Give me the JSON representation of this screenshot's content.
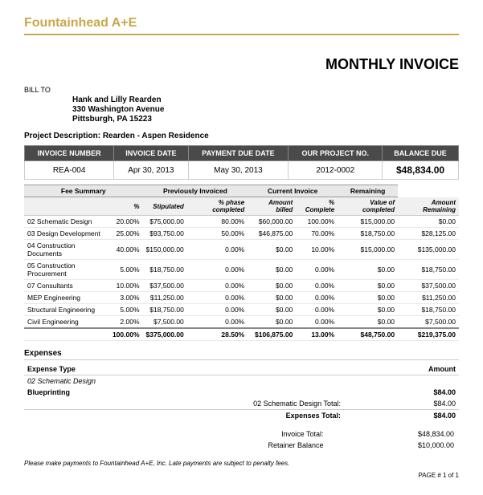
{
  "company": {
    "name": "Fountainhead",
    "suffix": " A+E"
  },
  "invoice_title": "MONTHLY INVOICE",
  "bill_to_label": "BILL TO",
  "client": {
    "name": "Hank and Lilly Rearden",
    "address1": "330 Washington Avenue",
    "address2": "Pittsburgh,  PA  15223"
  },
  "project_description_label": "Project Description:",
  "project_description": "Rearden - Aspen Residence",
  "table_headers": {
    "invoice_number": "INVOICE NUMBER",
    "invoice_date": "INVOICE DATE",
    "payment_due_date": "PAYMENT DUE DATE",
    "our_project_no": "OUR PROJECT NO.",
    "balance_due": "BALANCE DUE"
  },
  "invoice_info": {
    "invoice_number": "REA-004",
    "invoice_date": "Apr 30, 2013",
    "payment_due_date": "May 30, 2013",
    "project_no": "2012-0002",
    "balance_due": "$48,834.00"
  },
  "fee_summary": {
    "group_headers": [
      "Fee Summary",
      "Previously Invoiced",
      "Current Invoice",
      "Remaining"
    ],
    "sub_headers": [
      "",
      "%",
      "Stipulated",
      "% phase completed",
      "Amount billed",
      "%\nComplete",
      "Value of completed",
      "Amount Remaining"
    ],
    "rows": [
      {
        "label": "02 Schematic Design",
        "pct": "20.00%",
        "stipulated": "$75,000.00",
        "phase_pct": "80.00%",
        "amount_billed": "$60,000.00",
        "complete_pct": "100.00%",
        "value_completed": "$15,000.00",
        "remaining": "$0.00"
      },
      {
        "label": "03 Design Development",
        "pct": "25.00%",
        "stipulated": "$93,750.00",
        "phase_pct": "50.00%",
        "amount_billed": "$46,875.00",
        "complete_pct": "70.00%",
        "value_completed": "$18,750.00",
        "remaining": "$28,125.00"
      },
      {
        "label": "04 Construction Documents",
        "pct": "40.00%",
        "stipulated": "$150,000.00",
        "phase_pct": "0.00%",
        "amount_billed": "$0.00",
        "complete_pct": "10.00%",
        "value_completed": "$15,000.00",
        "remaining": "$135,000.00"
      },
      {
        "label": "05 Construction Procurement",
        "pct": "5.00%",
        "stipulated": "$18,750.00",
        "phase_pct": "0.00%",
        "amount_billed": "$0.00",
        "complete_pct": "0.00%",
        "value_completed": "$0.00",
        "remaining": "$18,750.00"
      },
      {
        "label": "07 Consultants",
        "pct": "10.00%",
        "stipulated": "$37,500.00",
        "phase_pct": "0.00%",
        "amount_billed": "$0.00",
        "complete_pct": "0.00%",
        "value_completed": "$0.00",
        "remaining": "$37,500.00"
      },
      {
        "label": "  MEP Engineering",
        "pct": "3.00%",
        "stipulated": "$11,250.00",
        "phase_pct": "0.00%",
        "amount_billed": "$0.00",
        "complete_pct": "0.00%",
        "value_completed": "$0.00",
        "remaining": "$11,250.00"
      },
      {
        "label": "  Structural Engineering",
        "pct": "5.00%",
        "stipulated": "$18,750.00",
        "phase_pct": "0.00%",
        "amount_billed": "$0.00",
        "complete_pct": "0.00%",
        "value_completed": "$0.00",
        "remaining": "$18,750.00"
      },
      {
        "label": "  Civil Engineering",
        "pct": "2.00%",
        "stipulated": "$7,500.00",
        "phase_pct": "0.00%",
        "amount_billed": "$0.00",
        "complete_pct": "0.00%",
        "value_completed": "$0.00",
        "remaining": "$7,500.00"
      }
    ],
    "total": {
      "label": "",
      "pct": "100.00%",
      "stipulated": "$375,000.00",
      "phase_pct": "28.50%",
      "amount_billed": "$106,875.00",
      "complete_pct": "13.00%",
      "value_completed": "$48,750.00",
      "remaining": "$219,375.00"
    }
  },
  "expenses": {
    "header": "Expenses",
    "col_type": "Expense Type",
    "col_amount": "Amount",
    "category": "02 Schematic Design",
    "items": [
      {
        "label": "Blueprinting",
        "amount": "$84.00"
      }
    ],
    "subtotal_label": "02 Schematic Design Total:",
    "subtotal_amount": "$84.00",
    "total_label": "Expenses Total:",
    "total_amount": "$84.00"
  },
  "invoice_totals": {
    "invoice_total_label": "Invoice Total:",
    "invoice_total_amount": "$48,834.00",
    "retainer_label": "Retainer Balance",
    "retainer_amount": "$10,000.00"
  },
  "footer": {
    "note": "Please make payments to Fountainhead A+E, Inc. Late payments are subject to penalty fees.",
    "page": "PAGE # 1 of 1"
  }
}
